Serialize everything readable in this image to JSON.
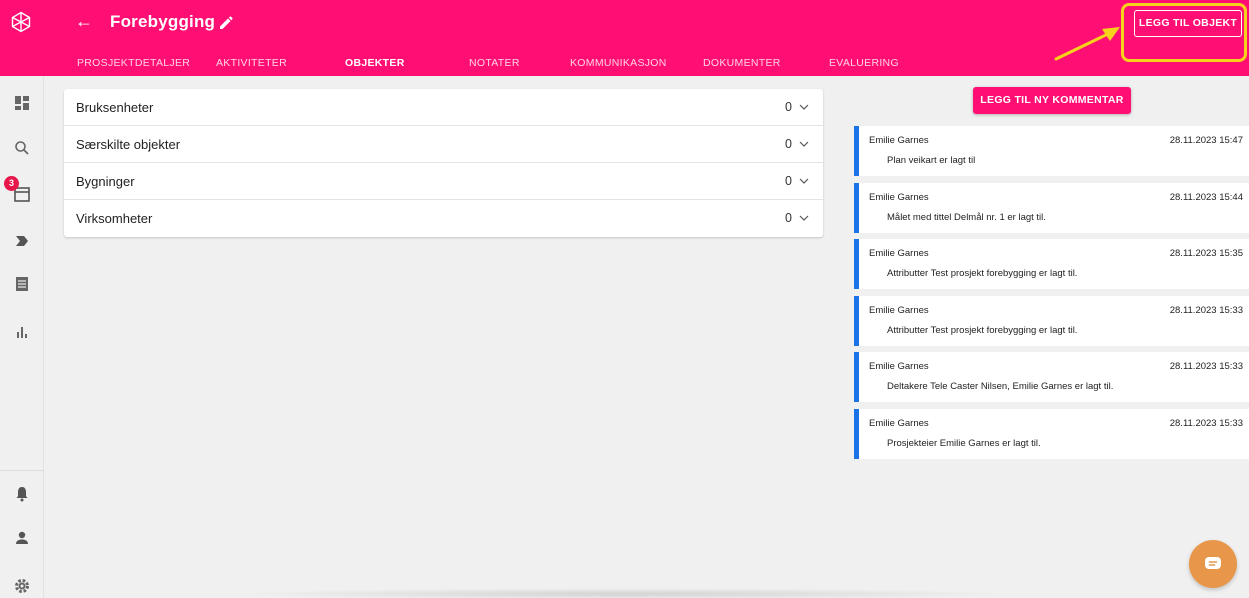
{
  "header": {
    "title": "Forebygging",
    "add_object_label": "LEGG TIL OBJEKT",
    "accent_color": "#ff0f73",
    "highlight_color": "#f7d21b",
    "tabs": [
      {
        "label": "PROSJEKTDETALJER",
        "active": false
      },
      {
        "label": "AKTIVITETER",
        "active": false
      },
      {
        "label": "OBJEKTER",
        "active": true
      },
      {
        "label": "NOTATER",
        "active": false
      },
      {
        "label": "KOMMUNIKASJON",
        "active": false
      },
      {
        "label": "DOKUMENTER",
        "active": false
      },
      {
        "label": "EVALUERING",
        "active": false
      }
    ]
  },
  "sidebar": {
    "items": [
      {
        "icon": "dashboard-icon"
      },
      {
        "icon": "search-icon"
      },
      {
        "icon": "calendar-icon",
        "badge": "3"
      },
      {
        "icon": "label-icon"
      },
      {
        "icon": "list-icon"
      },
      {
        "icon": "bar-chart-icon"
      }
    ],
    "bottom_items": [
      {
        "icon": "bell-icon"
      },
      {
        "icon": "user-icon"
      },
      {
        "icon": "gear-icon"
      }
    ]
  },
  "objects": [
    {
      "label": "Bruksenheter",
      "count": "0"
    },
    {
      "label": "Særskilte objekter",
      "count": "0"
    },
    {
      "label": "Bygninger",
      "count": "0"
    },
    {
      "label": "Virksomheter",
      "count": "0"
    }
  ],
  "comments": {
    "add_label": "LEGG TIL NY KOMMENTAR",
    "accent_color": "#1a73e8",
    "items": [
      {
        "author": "Emilie Garnes",
        "time": "28.11.2023 15:47",
        "text": "Plan veikart er lagt til"
      },
      {
        "author": "Emilie Garnes",
        "time": "28.11.2023 15:44",
        "text": "Målet med tittel Delmål nr. 1 er lagt til."
      },
      {
        "author": "Emilie Garnes",
        "time": "28.11.2023 15:35",
        "text": "Attributter Test prosjekt forebygging er lagt til."
      },
      {
        "author": "Emilie Garnes",
        "time": "28.11.2023 15:33",
        "text": "Attributter Test prosjekt forebygging er lagt til."
      },
      {
        "author": "Emilie Garnes",
        "time": "28.11.2023 15:33",
        "text": "Deltakere Tele Caster Nilsen, Emilie Garnes er lagt til."
      },
      {
        "author": "Emilie Garnes",
        "time": "28.11.2023 15:33",
        "text": "Prosjekteier Emilie Garnes er lagt til."
      }
    ]
  }
}
